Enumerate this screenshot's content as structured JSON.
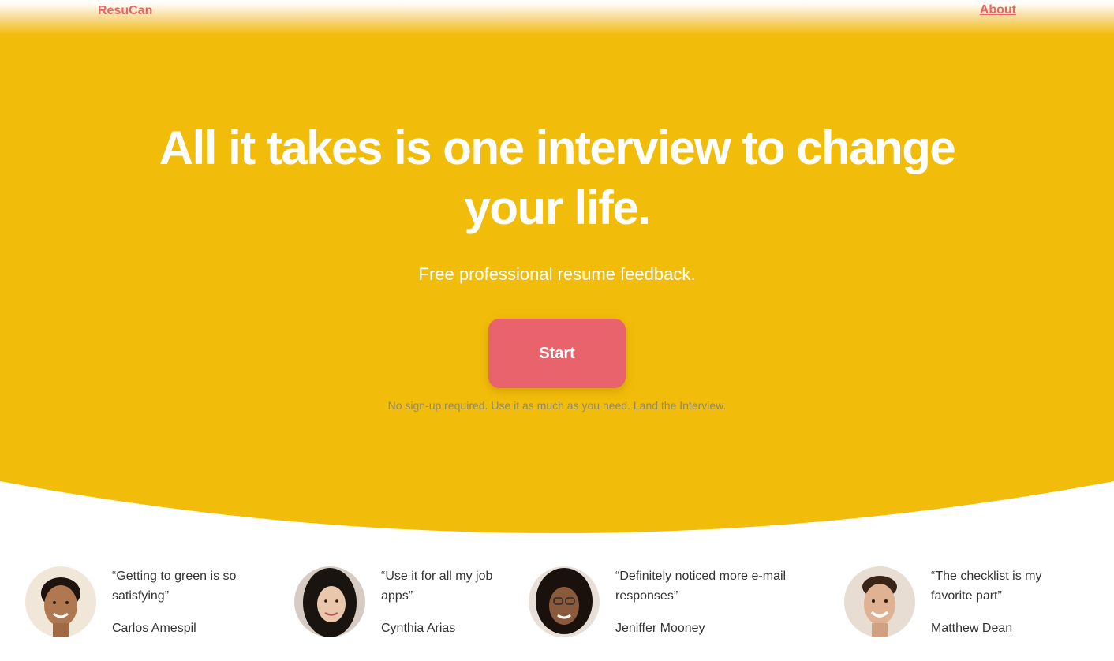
{
  "brand": {
    "name": "ResuCan"
  },
  "nav": {
    "about_label": "About"
  },
  "hero": {
    "headline_line1": "All it takes is one interview to change",
    "headline_line2": "your life.",
    "subheadline": "Free professional resume feedback.",
    "cta_label": "Start",
    "note": "No sign-up required. Use it as much as you need. Land the Interview."
  },
  "colors": {
    "hero_background": "#f2bc0a",
    "accent": "#e8636b",
    "text_white": "#ffffff"
  },
  "testimonials": [
    {
      "quote": "“Getting to green is so satisfying”",
      "author": "Carlos Amespil"
    },
    {
      "quote": "“Use it for all my job apps”",
      "author": "Cynthia Arias"
    },
    {
      "quote": "“Definitely noticed more e-mail responses”",
      "author": "Jeniffer Mooney"
    },
    {
      "quote": "“The checklist is my favorite part”",
      "author": "Matthew Dean"
    }
  ]
}
